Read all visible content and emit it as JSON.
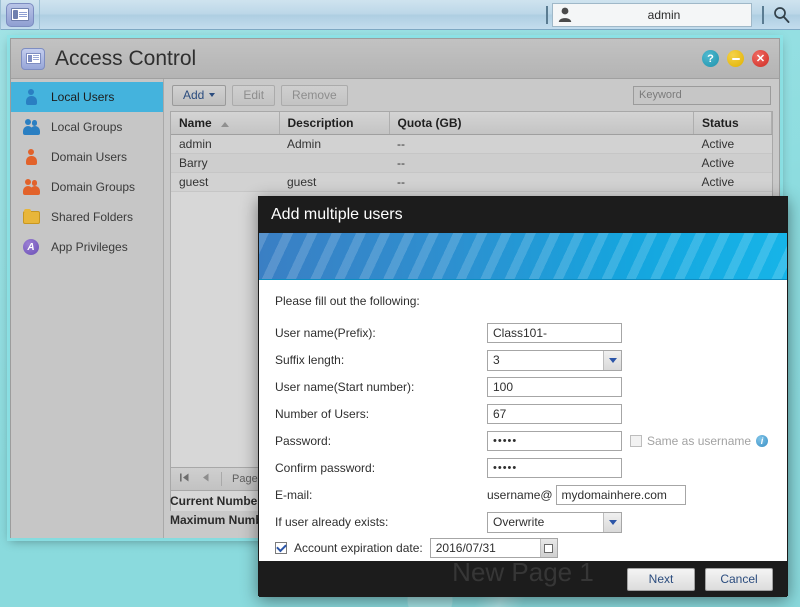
{
  "taskbar": {
    "app_icon": "id-card-icon",
    "user_name": "admin",
    "search_icon": "search-icon"
  },
  "window": {
    "title": "Access Control",
    "icon": "id-card-icon",
    "controls": {
      "help": "?",
      "minimize": "—",
      "close": "✕"
    }
  },
  "sidebar": {
    "items": [
      {
        "label": "Local Users",
        "icon": "user-blue-icon",
        "active": true
      },
      {
        "label": "Local Groups",
        "icon": "users-blue-icon",
        "active": false
      },
      {
        "label": "Domain Users",
        "icon": "user-orange-icon",
        "active": false
      },
      {
        "label": "Domain Groups",
        "icon": "users-orange-icon",
        "active": false
      },
      {
        "label": "Shared Folders",
        "icon": "folder-icon",
        "active": false
      },
      {
        "label": "App Privileges",
        "icon": "app-privileges-icon",
        "active": false
      }
    ]
  },
  "toolbar": {
    "add_label": "Add",
    "edit_label": "Edit",
    "remove_label": "Remove",
    "keyword_placeholder": "Keyword",
    "keyword_value": ""
  },
  "table": {
    "columns": [
      "Name",
      "Description",
      "Quota (GB)",
      "Status"
    ],
    "sort_column": "Name",
    "sort_direction": "asc",
    "rows": [
      {
        "name": "admin",
        "description": "Admin",
        "quota": "--",
        "status": "Active"
      },
      {
        "name": "Barry",
        "description": "",
        "quota": "--",
        "status": "Active"
      },
      {
        "name": "guest",
        "description": "guest",
        "quota": "--",
        "status": "Active"
      }
    ]
  },
  "pagination": {
    "first_icon": "first-page-icon",
    "prev_icon": "previous-page-icon",
    "page_label": "Page"
  },
  "counters": {
    "current": "Current Number",
    "maximum": "Maximum Numb"
  },
  "dialog": {
    "title": "Add multiple users",
    "intro": "Please fill out the following:",
    "fields": {
      "username_prefix": {
        "label": "User name(Prefix):",
        "value": "Class101-"
      },
      "suffix_length": {
        "label": "Suffix length:",
        "value": "3"
      },
      "start_number": {
        "label": "User name(Start number):",
        "value": "100"
      },
      "number_of_users": {
        "label": "Number of Users:",
        "value": "67"
      },
      "password": {
        "label": "Password:",
        "value": "•••••"
      },
      "confirm_password": {
        "label": "Confirm password:",
        "value": "•••••"
      },
      "same_as_username": {
        "label": "Same as username",
        "checked": false,
        "info_icon": "info-icon"
      },
      "email": {
        "label": "E-mail:",
        "prefix": "username@",
        "value": "mydomainhere.com"
      },
      "if_exists": {
        "label": "If user already exists:",
        "value": "Overwrite"
      },
      "expiration": {
        "label": "Account expiration date:",
        "checked": true,
        "value": "2016/07/31",
        "calendar_icon": "calendar-icon"
      }
    },
    "buttons": {
      "next": "Next",
      "cancel": "Cancel"
    }
  },
  "watermark": "New Page 1",
  "colors": {
    "accent_blue": "#44b3dd",
    "desktop": "#8ddde0",
    "dialog_bar": "#1c1c1c",
    "link_text": "#2b4c7e"
  }
}
